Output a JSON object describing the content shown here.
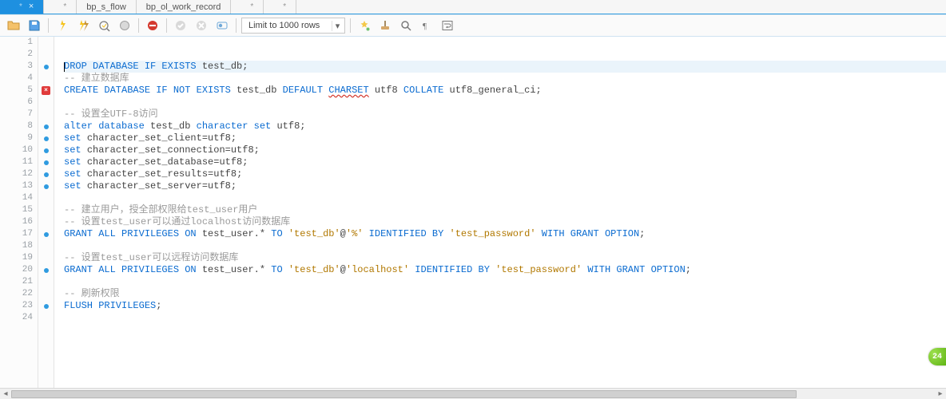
{
  "badge": {
    "count": "24"
  },
  "tabs": [
    {
      "label": "",
      "dirty": "*",
      "active": true
    },
    {
      "label": "",
      "dirty": "*",
      "active": false
    },
    {
      "label": "bp_s_flow",
      "dirty": "",
      "active": false
    },
    {
      "label": "bp_ol_work_record",
      "dirty": "",
      "active": false
    },
    {
      "label": "",
      "dirty": "*",
      "active": false
    },
    {
      "label": "",
      "dirty": "*",
      "active": false
    }
  ],
  "toolbar": {
    "limit_label": "Limit to 1000 rows"
  },
  "code": {
    "lines": [
      {
        "n": 1,
        "mark": "",
        "hl": false,
        "tok": []
      },
      {
        "n": 2,
        "mark": "",
        "hl": false,
        "tok": []
      },
      {
        "n": 3,
        "mark": "dot",
        "hl": true,
        "tok": [
          {
            "c": "caret",
            "t": ""
          },
          {
            "c": "kw",
            "t": "DROP DATABASE IF EXISTS "
          },
          {
            "c": "ident",
            "t": "test_db"
          },
          {
            "c": "punct",
            "t": ";"
          }
        ]
      },
      {
        "n": 4,
        "mark": "",
        "hl": false,
        "tok": [
          {
            "c": "cmt",
            "t": "-- 建立数据库"
          }
        ]
      },
      {
        "n": 5,
        "mark": "err",
        "hl": false,
        "tok": [
          {
            "c": "kw",
            "t": "CREATE DATABASE IF NOT EXISTS "
          },
          {
            "c": "ident",
            "t": "test_db "
          },
          {
            "c": "kw",
            "t": "DEFAULT "
          },
          {
            "c": "kw wavy",
            "t": "CHARSET"
          },
          {
            "c": "ident",
            "t": " utf8 "
          },
          {
            "c": "kw",
            "t": "COLLATE "
          },
          {
            "c": "ident",
            "t": "utf8_general_ci"
          },
          {
            "c": "punct",
            "t": ";"
          }
        ]
      },
      {
        "n": 6,
        "mark": "",
        "hl": false,
        "tok": []
      },
      {
        "n": 7,
        "mark": "",
        "hl": false,
        "tok": [
          {
            "c": "cmt",
            "t": "-- 设置全UTF-8访问"
          }
        ]
      },
      {
        "n": 8,
        "mark": "dot",
        "hl": false,
        "tok": [
          {
            "c": "kw",
            "t": "alter database "
          },
          {
            "c": "ident",
            "t": "test_db "
          },
          {
            "c": "kw",
            "t": "character set "
          },
          {
            "c": "ident",
            "t": "utf8"
          },
          {
            "c": "punct",
            "t": ";"
          }
        ]
      },
      {
        "n": 9,
        "mark": "dot",
        "hl": false,
        "tok": [
          {
            "c": "kw",
            "t": "set "
          },
          {
            "c": "ident",
            "t": "character_set_client"
          },
          {
            "c": "punct",
            "t": "="
          },
          {
            "c": "ident",
            "t": "utf8"
          },
          {
            "c": "punct",
            "t": ";"
          }
        ]
      },
      {
        "n": 10,
        "mark": "dot",
        "hl": false,
        "tok": [
          {
            "c": "kw",
            "t": "set "
          },
          {
            "c": "ident",
            "t": "character_set_connection"
          },
          {
            "c": "punct",
            "t": "="
          },
          {
            "c": "ident",
            "t": "utf8"
          },
          {
            "c": "punct",
            "t": ";"
          }
        ]
      },
      {
        "n": 11,
        "mark": "dot",
        "hl": false,
        "tok": [
          {
            "c": "kw",
            "t": "set "
          },
          {
            "c": "ident",
            "t": "character_set_database"
          },
          {
            "c": "punct",
            "t": "="
          },
          {
            "c": "ident",
            "t": "utf8"
          },
          {
            "c": "punct",
            "t": ";"
          }
        ]
      },
      {
        "n": 12,
        "mark": "dot",
        "hl": false,
        "tok": [
          {
            "c": "kw",
            "t": "set "
          },
          {
            "c": "ident",
            "t": "character_set_results"
          },
          {
            "c": "punct",
            "t": "="
          },
          {
            "c": "ident",
            "t": "utf8"
          },
          {
            "c": "punct",
            "t": ";"
          }
        ]
      },
      {
        "n": 13,
        "mark": "dot",
        "hl": false,
        "tok": [
          {
            "c": "kw",
            "t": "set "
          },
          {
            "c": "ident",
            "t": "character_set_server"
          },
          {
            "c": "punct",
            "t": "="
          },
          {
            "c": "ident",
            "t": "utf8"
          },
          {
            "c": "punct",
            "t": ";"
          }
        ]
      },
      {
        "n": 14,
        "mark": "",
        "hl": false,
        "tok": []
      },
      {
        "n": 15,
        "mark": "",
        "hl": false,
        "tok": [
          {
            "c": "cmt",
            "t": "-- 建立用户，授全部权限给test_user用户"
          }
        ]
      },
      {
        "n": 16,
        "mark": "",
        "hl": false,
        "tok": [
          {
            "c": "cmt",
            "t": "-- 设置test_user可以通过localhost访问数据库"
          }
        ]
      },
      {
        "n": 17,
        "mark": "dot",
        "hl": false,
        "tok": [
          {
            "c": "kw",
            "t": "GRANT ALL PRIVILEGES ON "
          },
          {
            "c": "ident",
            "t": "test_user.* "
          },
          {
            "c": "kw",
            "t": "TO "
          },
          {
            "c": "str",
            "t": "'test_db'"
          },
          {
            "c": "ident",
            "t": "@"
          },
          {
            "c": "str",
            "t": "'%'"
          },
          {
            "c": "kw",
            "t": " IDENTIFIED BY "
          },
          {
            "c": "str",
            "t": "'test_password'"
          },
          {
            "c": "kw",
            "t": " WITH GRANT OPTION"
          },
          {
            "c": "punct",
            "t": ";"
          }
        ]
      },
      {
        "n": 18,
        "mark": "",
        "hl": false,
        "tok": []
      },
      {
        "n": 19,
        "mark": "",
        "hl": false,
        "tok": [
          {
            "c": "cmt",
            "t": "-- 设置test_user可以远程访问数据库"
          }
        ]
      },
      {
        "n": 20,
        "mark": "dot",
        "hl": false,
        "tok": [
          {
            "c": "kw",
            "t": "GRANT ALL PRIVILEGES ON "
          },
          {
            "c": "ident",
            "t": "test_user.* "
          },
          {
            "c": "kw",
            "t": "TO "
          },
          {
            "c": "str",
            "t": "'test_db'"
          },
          {
            "c": "ident",
            "t": "@"
          },
          {
            "c": "str",
            "t": "'localhost'"
          },
          {
            "c": "kw",
            "t": " IDENTIFIED BY "
          },
          {
            "c": "str",
            "t": "'test_password'"
          },
          {
            "c": "kw",
            "t": " WITH GRANT OPTION"
          },
          {
            "c": "punct",
            "t": ";"
          }
        ]
      },
      {
        "n": 21,
        "mark": "",
        "hl": false,
        "tok": []
      },
      {
        "n": 22,
        "mark": "",
        "hl": false,
        "tok": [
          {
            "c": "cmt",
            "t": "-- 刷新权限"
          }
        ]
      },
      {
        "n": 23,
        "mark": "dot",
        "hl": false,
        "tok": [
          {
            "c": "kw",
            "t": "FLUSH PRIVILEGES"
          },
          {
            "c": "punct",
            "t": ";"
          }
        ]
      },
      {
        "n": 24,
        "mark": "",
        "hl": false,
        "tok": []
      }
    ]
  }
}
